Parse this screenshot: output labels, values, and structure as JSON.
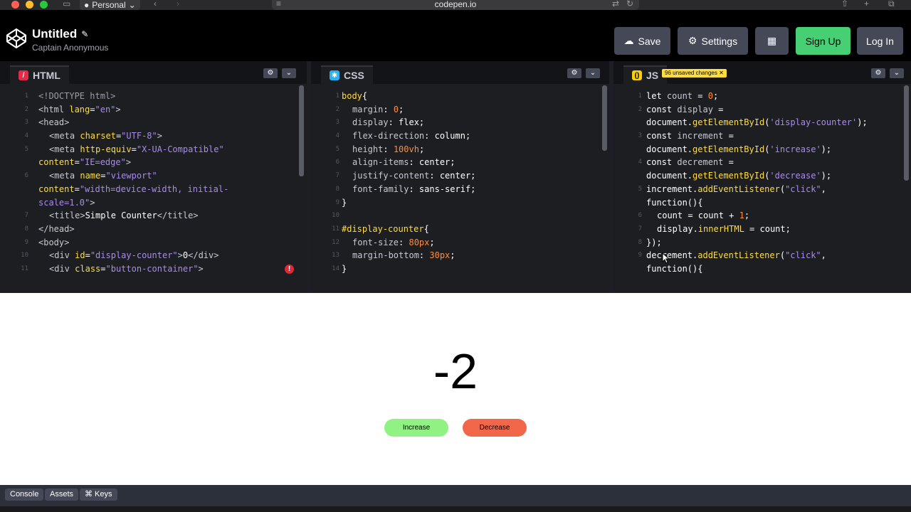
{
  "browser": {
    "profile": "Personal",
    "url": "codepen.io"
  },
  "header": {
    "title": "Untitled",
    "author": "Captain Anonymous",
    "save_label": "Save",
    "settings_label": "Settings",
    "signup_label": "Sign Up",
    "login_label": "Log In"
  },
  "editors": {
    "html": {
      "label": "HTML"
    },
    "css": {
      "label": "CSS"
    },
    "js": {
      "label": "JS",
      "unsaved": "96 unsaved changes"
    }
  },
  "preview": {
    "counter": "-2",
    "increase_label": "Increase",
    "decrease_label": "Decrease"
  },
  "footer": {
    "console": "Console",
    "assets": "Assets",
    "keys": "⌘ Keys"
  },
  "colors": {
    "accent_green": "#47cf73",
    "increase_bg": "#8ff283",
    "decrease_bg": "#f2664a",
    "html_badge": "#e42c4a",
    "css_badge": "#2bb2f2",
    "js_badge": "#fcd000"
  }
}
